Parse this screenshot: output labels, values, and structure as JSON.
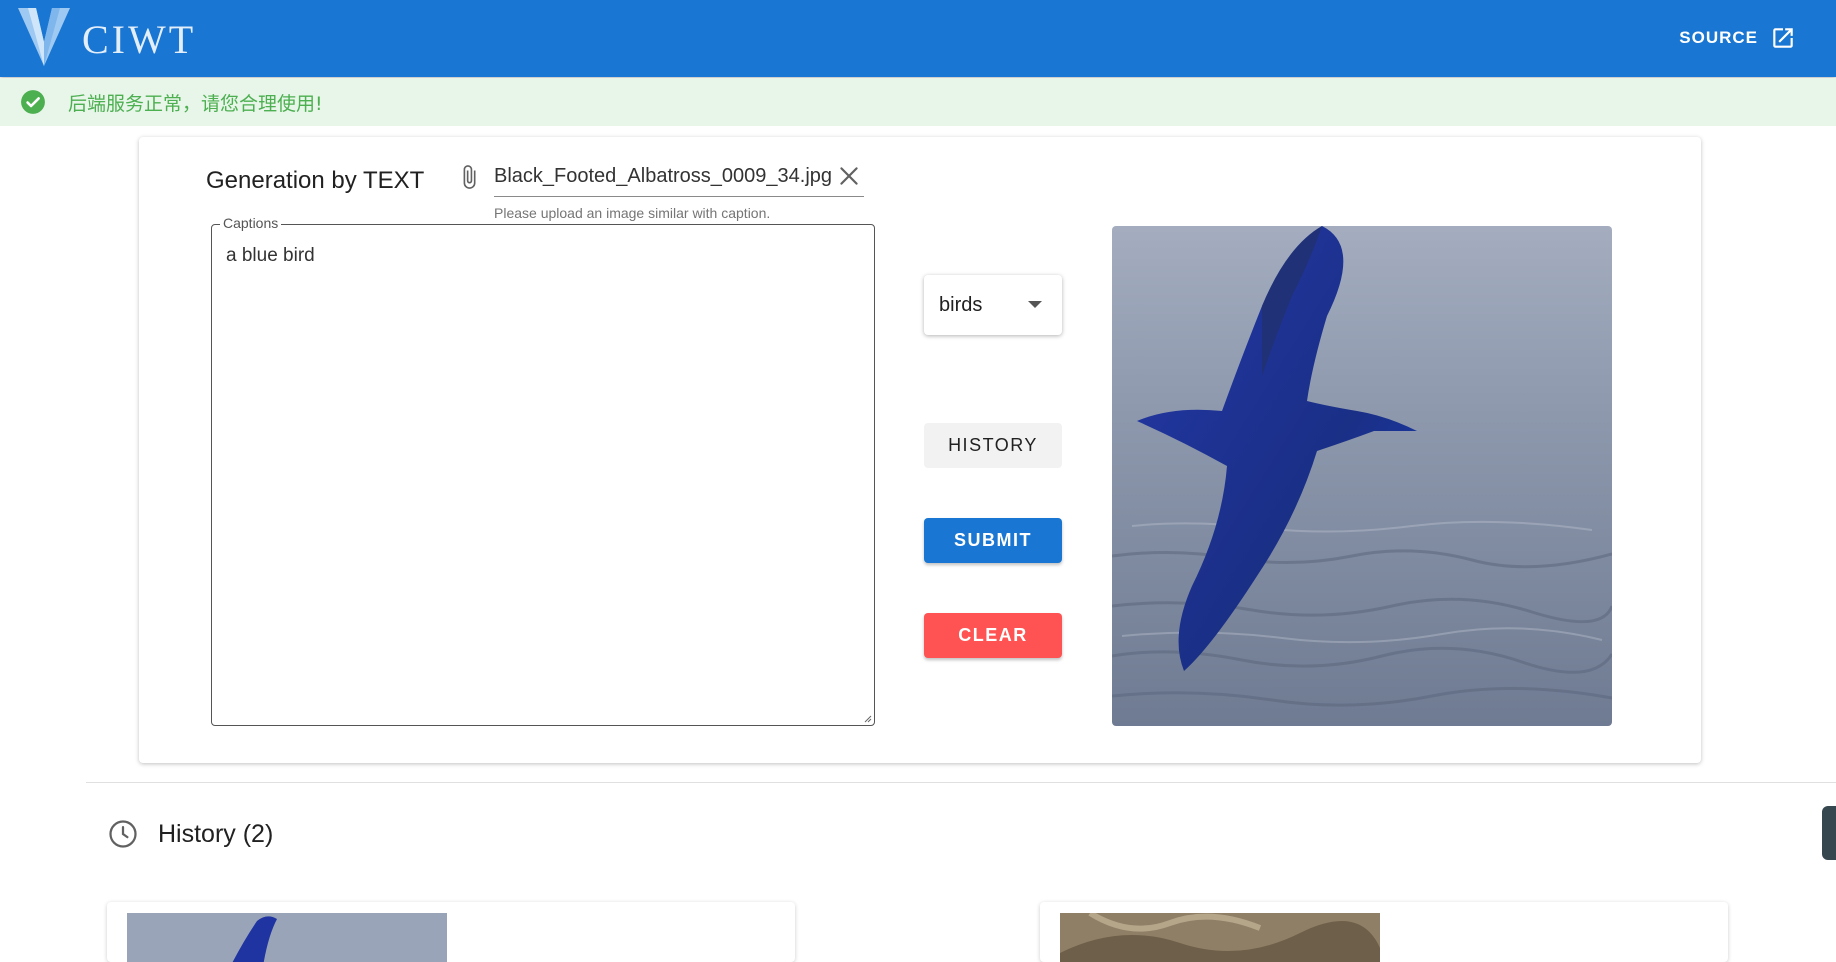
{
  "app": {
    "logo_text": "CIWT",
    "source_label": "SOURCE"
  },
  "alert": {
    "message": "后端服务正常，请您合理使用!"
  },
  "generator": {
    "title": "Generation by TEXT",
    "file_name": "Black_Footed_Albatross_0009_34.jpg",
    "file_hint": "Please upload an image similar with caption.",
    "captions_label": "Captions",
    "captions_value": "a blue bird",
    "dataset_selected": "birds",
    "history_button": "HISTORY",
    "submit_button": "SUBMIT",
    "clear_button": "CLEAR"
  },
  "history": {
    "title": "History (2)"
  },
  "colors": {
    "primary": "#1976d2",
    "error": "#ff5252",
    "success": "#4caf50",
    "alert_bg": "#e8f5e9"
  },
  "icons": [
    "logo-icon",
    "open-in-new-icon",
    "check-circle-icon",
    "paperclip-icon",
    "close-icon",
    "dropdown-arrow-icon",
    "clock-icon"
  ]
}
